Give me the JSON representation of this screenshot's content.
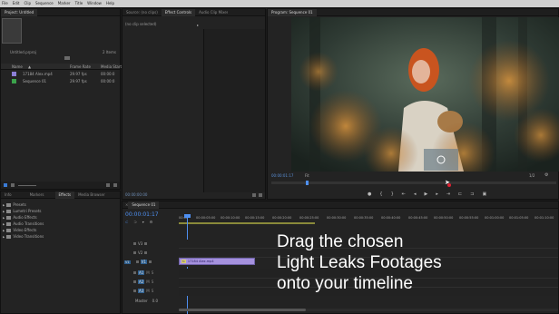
{
  "menu": [
    "File",
    "Edit",
    "Clip",
    "Sequence",
    "Marker",
    "Title",
    "Window",
    "Help"
  ],
  "project": {
    "tab": "Project: Untitled",
    "file_name": "Untitled.prproj",
    "item_count": "2 Items",
    "columns": [
      "Name",
      "Frame Rate",
      "Media Start"
    ],
    "rows": [
      {
        "name": "17184 Alex.mp4",
        "rate": "29.97 fps",
        "start": "00:00:0"
      },
      {
        "name": "Sequence 01",
        "rate": "29.97 fps",
        "start": "00:00:0"
      }
    ]
  },
  "source": {
    "tabs": [
      "Source: (no clips)",
      "Effect Controls",
      "Audio Clip Mixer: Sequence 01"
    ],
    "no_clip": "(no clip selected)",
    "timecode": "00:00:00:00"
  },
  "program": {
    "tab": "Program: Sequence 01",
    "timecode": "00:00:01:17",
    "fit": "Fit",
    "quality": "1/2",
    "end_time": "00:00:00"
  },
  "effects": {
    "tabs": [
      "Info",
      "Markers",
      "Effects",
      "Media Browser"
    ],
    "items": [
      "Presets",
      "Lumetri Presets",
      "Audio Effects",
      "Audio Transitions",
      "Video Effects",
      "Video Transitions"
    ]
  },
  "timeline": {
    "tab": "Sequence 01",
    "timecode": "00:00:01:17",
    "ruler": [
      "00:00",
      "00:00:05:00",
      "00:00:10:00",
      "00:00:15:00",
      "00:00:20:00",
      "00:00:25:00",
      "00:00:30:00",
      "00:00:35:00",
      "00:00:40:00",
      "00:00:45:00",
      "00:00:50:00",
      "00:00:55:00",
      "00:01:00:00",
      "00:01:05:00",
      "00:01:10:00"
    ],
    "video_tracks": [
      "V3",
      "V2",
      "V1"
    ],
    "audio_tracks": [
      "A1",
      "A2",
      "A3"
    ],
    "master": "Master",
    "master_val": "0.0",
    "clip_label": "17184 Alex.mp4"
  },
  "overlay": {
    "line1": "Drag the chosen",
    "line2": "Light Leaks Footages",
    "line3": "onto your timeline"
  }
}
